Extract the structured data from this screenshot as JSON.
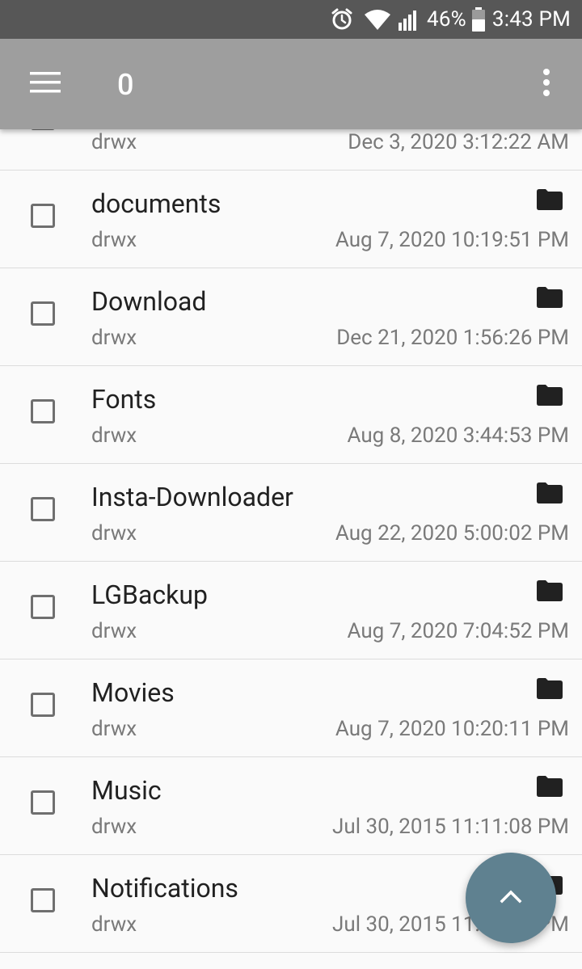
{
  "status_bar": {
    "battery_percent": "46%",
    "time": "3:43 PM",
    "icons": [
      "alarm-icon",
      "wifi-icon",
      "signal-icon",
      "battery-icon"
    ]
  },
  "app_bar": {
    "title": "0",
    "icons": [
      "menu-icon",
      "more-vert-icon"
    ]
  },
  "files": [
    {
      "name": "",
      "perm": "drwx",
      "date": "Dec 3, 2020 3:12:22 AM"
    },
    {
      "name": "documents",
      "perm": "drwx",
      "date": "Aug 7, 2020 10:19:51 PM"
    },
    {
      "name": "Download",
      "perm": "drwx",
      "date": "Dec 21, 2020 1:56:26 PM"
    },
    {
      "name": "Fonts",
      "perm": "drwx",
      "date": "Aug 8, 2020 3:44:53 PM"
    },
    {
      "name": "Insta-Downloader",
      "perm": "drwx",
      "date": "Aug 22, 2020 5:00:02 PM"
    },
    {
      "name": "LGBackup",
      "perm": "drwx",
      "date": "Aug 7, 2020 7:04:52 PM"
    },
    {
      "name": "Movies",
      "perm": "drwx",
      "date": "Aug 7, 2020 10:20:11 PM"
    },
    {
      "name": "Music",
      "perm": "drwx",
      "date": "Jul 30, 2015 11:11:08 PM"
    },
    {
      "name": "Notifications",
      "perm": "drwx",
      "date": "Jul 30, 2015 11:11:08 PM"
    }
  ],
  "fab": {
    "icon": "chevron-up-icon"
  },
  "colors": {
    "status_bar": "#575757",
    "app_bar": "#9e9e9e",
    "fab": "#5f8190",
    "background": "#fafafa"
  }
}
